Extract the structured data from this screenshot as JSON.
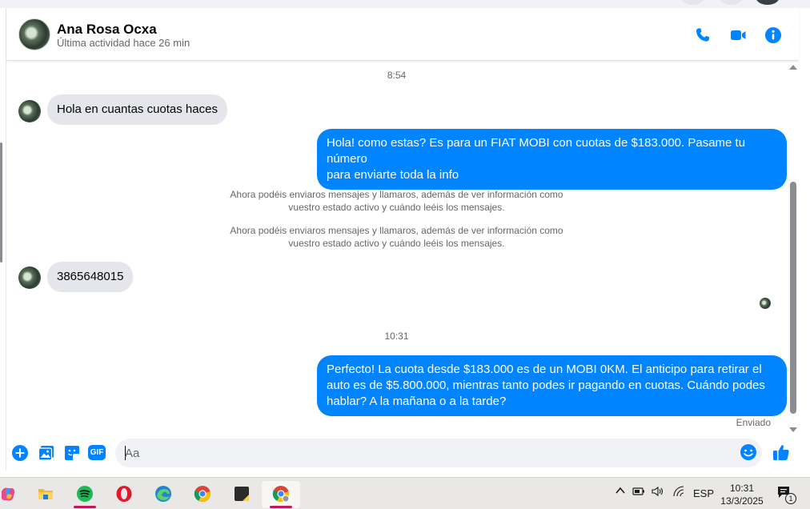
{
  "contact": {
    "name": "Ana Rosa Ocxa",
    "status": "Última actividad hace 26 min"
  },
  "header_actions": [
    {
      "icon": "phone-icon"
    },
    {
      "icon": "video-camera-icon"
    },
    {
      "icon": "info-icon"
    }
  ],
  "messages": {
    "timestamp_1": "8:54",
    "incoming_1": "Hola en cuantas cuotas haces",
    "outgoing_1_line1": "Hola! como estas? Es para un FIAT MOBI con cuotas de $183.000. Pasame tu número",
    "outgoing_1_line2": "para enviarte toda la info",
    "system_note_1_line1": "Ahora podéis enviaros mensajes y llamaros, además de ver información como",
    "system_note_1_line2": "vuestro estado activo y cuándo leéis los mensajes.",
    "system_note_2_line1": "Ahora podéis enviaros mensajes y llamaros, además de ver información como",
    "system_note_2_line2": "vuestro estado activo y cuándo leéis los mensajes.",
    "incoming_2": "3865648015",
    "timestamp_2": "10:31",
    "outgoing_2_line1": "Perfecto! La cuota desde $183.000 es de un MOBI 0KM. El anticipo para retirar el",
    "outgoing_2_line2": "auto es de $5.800.000, mientras tanto podes ir pagando en cuotas. Cuándo podes",
    "outgoing_2_line3": "hablar? A la mañana o a la tarde?",
    "sent_label": "Enviado"
  },
  "composer": {
    "placeholder": "Aa",
    "gif_label": "GIF",
    "actions": [
      "plus-icon",
      "photo-icon",
      "sticker-icon",
      "gif-icon",
      "emoji-icon",
      "thumbs-up-icon"
    ]
  },
  "taskbar": {
    "apps": [
      "copilot-icon",
      "file-explorer-icon",
      "spotify-icon",
      "opera-icon",
      "edge-icon",
      "chrome-icon",
      "notes-icon",
      "chrome-profile-icon"
    ],
    "language": "ESP",
    "time": "10:31",
    "date": "13/3/2025",
    "notification_count": "1"
  },
  "colors": {
    "accent": "#0084ff",
    "incoming_bubble": "#e4e6eb",
    "secondary_text": "#65676b"
  }
}
